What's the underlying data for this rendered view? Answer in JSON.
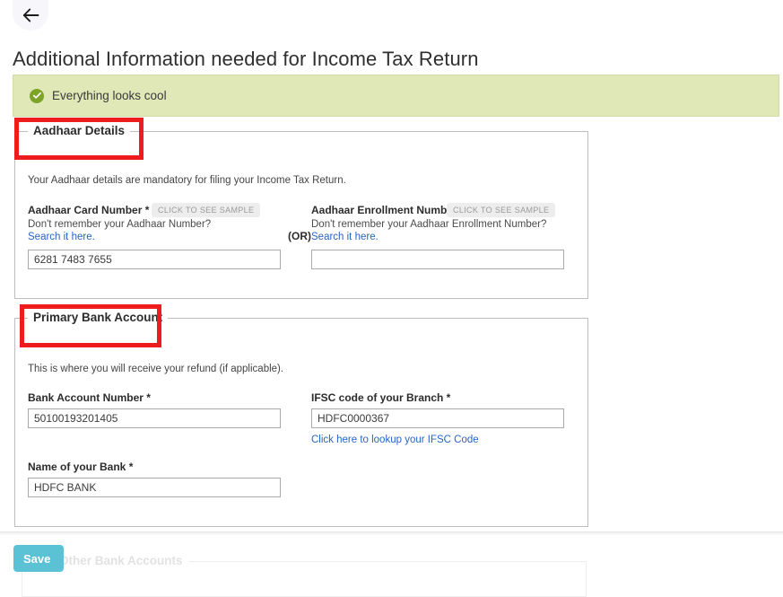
{
  "header": {
    "back_icon": "arrow-left-icon",
    "title": "Additional Information needed for Income Tax Return"
  },
  "banner": {
    "icon": "check-circle-icon",
    "message": "Everything looks cool",
    "background_color": "#dfe8b6",
    "icon_color": "#7ba428"
  },
  "aadhaar_section": {
    "legend": "Aadhaar Details",
    "description": "Your Aadhaar details are mandatory for filing your Income Tax Return.",
    "or_separator": "(OR)",
    "card_number": {
      "label": "Aadhaar Card Number *",
      "sample_badge": "CLICK TO SEE SAMPLE",
      "hint": "Don't remember your Aadhaar Number?",
      "link": "Search it here.",
      "value": "6281 7483 7655",
      "placeholder": ""
    },
    "enrollment_number": {
      "label": "Aadhaar Enrollment Number",
      "sample_badge": "CLICK TO SEE SAMPLE",
      "hint": "Don't remember your Aadhaar Enrollment Number?",
      "link": "Search it here.",
      "value": "",
      "placeholder": ""
    }
  },
  "bank_section": {
    "legend": "Primary Bank Account",
    "description": "This is where you will receive your refund (if applicable).",
    "account_number": {
      "label": "Bank Account Number *",
      "value": "50100193201405",
      "placeholder": ""
    },
    "ifsc": {
      "label": "IFSC code of your Branch *",
      "value": "HDFC0000367",
      "placeholder": "",
      "link": "Click here to lookup your IFSC Code"
    },
    "bank_name": {
      "label": "Name of your Bank *",
      "value": "HDFC BANK",
      "placeholder": ""
    }
  },
  "other_accounts_section": {
    "legend": "All Other Bank Accounts"
  },
  "footer": {
    "save_label": "Save",
    "save_color": "#5bc2d6"
  },
  "annotations": {
    "color": "#ee1c1c",
    "boxes": [
      "aadhaar-details-highlight",
      "primary-bank-account-highlight"
    ]
  }
}
